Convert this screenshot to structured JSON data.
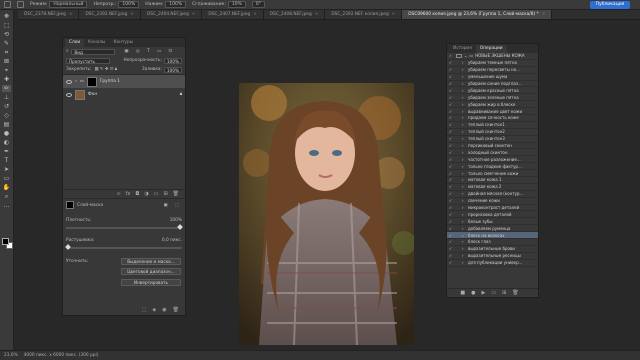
{
  "options_bar": {
    "mode_label": "Режим:",
    "mode_value": "Нормальный",
    "opacity_label": "Непрозр.:",
    "opacity_value": "100%",
    "pressure_label": "Нажим:",
    "pressure_value": "100%",
    "smoothing_label": "Сглаживание:",
    "smoothing_value": "10%",
    "angle_value": "0°",
    "publish_label": "Публикация"
  },
  "tabs": [
    {
      "label": "DSC_2378.NEF.jpeg"
    },
    {
      "label": "DSC_2392.NEF.jpeg"
    },
    {
      "label": "DSC_2404.NEF.jpeg"
    },
    {
      "label": "DSC_2407.NEF.jpeg"
    },
    {
      "label": "DSC_2408.NEF.jpeg"
    },
    {
      "label": "DSC_2392.NEF копия.jpeg"
    },
    {
      "label": "DSC09600 копия.jpeg @ 23,6% (Группа 1, Слой-маска/8) *"
    }
  ],
  "layers_panel": {
    "tabs": [
      "Слои",
      "Каналы",
      "Контуры"
    ],
    "filter_label": "Вид",
    "blend_mode": "Пропустить",
    "opacity_label": "Непрозрачность:",
    "opacity_value": "100%",
    "lock_label": "Закрепить:",
    "fill_label": "Заливка:",
    "fill_value": "100%",
    "layers": [
      {
        "name": "Группа 1"
      },
      {
        "name": "Фон"
      }
    ],
    "properties": {
      "mask_title": "Слой-маска",
      "density_label": "Плотность:",
      "density_value": "100%",
      "feather_label": "Растушевка:",
      "feather_value": "0,0 пикс.",
      "refine_label": "Уточнить:",
      "select_mask_button": "Выделение и маска...",
      "color_range_button": "Цветовой диапазон...",
      "invert_button": "Инвертировать"
    }
  },
  "ops_panel": {
    "tabs": [
      "История",
      "Операции"
    ],
    "set_name": "НОВЫЕ ЭКШЕНЫ КОЖА",
    "actions": [
      "убираем темные пятна",
      "убираем пересветы на...",
      "уменьшение шума",
      "убираем синие подглаз...",
      "убираем красные пятна",
      "убираем зеленые пятна",
      "убираем жир в блеске",
      "выравнивание цвет кожи",
      "придаем сочность коже",
      "теплый скинтон1",
      "теплый скинтон2",
      "теплый скинтон3",
      "персиковый скинтон",
      "холодный скинтон",
      "частотное разложение...",
      "только гладкие фактур...",
      "только смягчение кожи",
      "матовая кожа 1",
      "матовая кожа 2",
      "двойная мясная (контур...",
      "свечение кожи",
      "микроконтраст деталей",
      "прорисовка деталей",
      "белые зубы",
      "добавляем румянца",
      "блеск на волосах",
      "блеск глаз",
      "выразительные брови",
      "выразительные ресницы",
      "для публикации универ..."
    ]
  },
  "status_bar": {
    "zoom": "23,6%",
    "doc_size": "4000 пикс. x 6000 пикс. (300 ppi)"
  },
  "colors": {
    "accent": "#2f6fd1",
    "selection": "#56657a",
    "panel_bg": "#383838",
    "app_bg": "#282828"
  }
}
